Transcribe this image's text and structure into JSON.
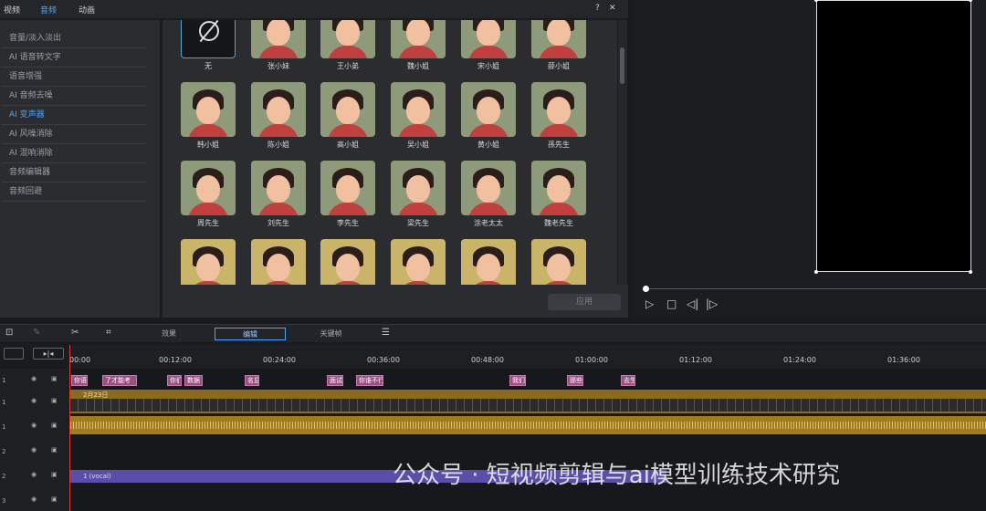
{
  "header": {
    "tabs": [
      "视频",
      "音频",
      "动画"
    ],
    "help": "?",
    "close": "✕"
  },
  "sidebar": {
    "items": [
      "音量/淡入淡出",
      "AI 语音转文字",
      "语音增强",
      "AI 音频去噪",
      "AI 变声器",
      "AI 风噪消除",
      "AI 混响消除",
      "音频编辑器",
      "音频回避"
    ]
  },
  "voices": [
    {
      "label": "无",
      "bg": "#151618",
      "none": true
    },
    {
      "label": "张小妹",
      "bg": "#8e9a7a"
    },
    {
      "label": "王小弟",
      "bg": "#8e9a7a"
    },
    {
      "label": "魏小姐",
      "bg": "#8e9a7a"
    },
    {
      "label": "宋小姐",
      "bg": "#8e9a7a"
    },
    {
      "label": "薛小姐",
      "bg": "#8e9a7a"
    },
    {
      "label": "韩小姐",
      "bg": "#8e9a7a"
    },
    {
      "label": "陈小姐",
      "bg": "#8e9a7a"
    },
    {
      "label": "高小姐",
      "bg": "#8e9a7a"
    },
    {
      "label": "吴小姐",
      "bg": "#8e9a7a"
    },
    {
      "label": "黄小姐",
      "bg": "#8e9a7a"
    },
    {
      "label": "孫先生",
      "bg": "#8e9a7a"
    },
    {
      "label": "周先生",
      "bg": "#8e9a7a"
    },
    {
      "label": "刘先生",
      "bg": "#8e9a7a"
    },
    {
      "label": "李先生",
      "bg": "#8e9a7a"
    },
    {
      "label": "梁先生",
      "bg": "#8e9a7a"
    },
    {
      "label": "涂老太太",
      "bg": "#8e9a7a"
    },
    {
      "label": "魏老先生",
      "bg": "#8e9a7a"
    },
    {
      "label": "",
      "bg": "#c9b46a"
    },
    {
      "label": "",
      "bg": "#c9b46a"
    },
    {
      "label": "",
      "bg": "#c9b46a"
    },
    {
      "label": "",
      "bg": "#c9b46a"
    },
    {
      "label": "",
      "bg": "#c9b46a"
    },
    {
      "label": "",
      "bg": "#c9b46a"
    }
  ],
  "footer": {
    "apply": "应用"
  },
  "timeline": {
    "tabs": [
      "效果",
      "编辑",
      "关键帧"
    ],
    "ruler": [
      "00:00",
      "00:12:00",
      "00:24:00",
      "00:36:00",
      "00:48:00",
      "01:00:00",
      "01:12:00",
      "01:24:00",
      "01:36:00"
    ],
    "subtitles": [
      "你语",
      "了才能考",
      "你们",
      "数据",
      "名显",
      "面试",
      "你谁不行",
      "我们",
      "那些",
      "去生"
    ],
    "video_date": "2月23日",
    "vocal_label": "1 (vocal)",
    "rows": [
      "1",
      "1",
      "1",
      "2",
      "2",
      "3"
    ]
  },
  "watermark": "公众号 · 短视频剪辑与ai模型训练技术研究"
}
